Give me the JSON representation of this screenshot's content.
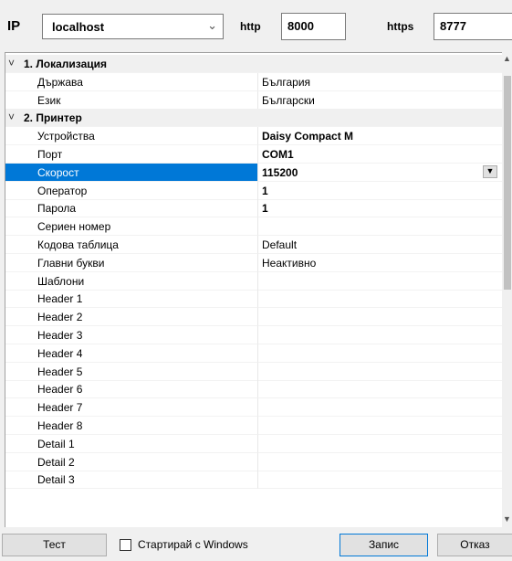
{
  "header": {
    "ip_label": "IP",
    "ip_value": "localhost",
    "http_label": "http",
    "http_value": "8000",
    "https_label": "https",
    "https_value": "8777"
  },
  "grid": {
    "rows": [
      {
        "type": "category",
        "label": "1. Локализация"
      },
      {
        "type": "prop",
        "label": "Държава",
        "value": "България",
        "bold": false
      },
      {
        "type": "prop",
        "label": "Език",
        "value": "Български",
        "bold": false
      },
      {
        "type": "category",
        "label": "2. Принтер"
      },
      {
        "type": "prop",
        "label": "Устройства",
        "value": "Daisy Compact M",
        "bold": true
      },
      {
        "type": "prop",
        "label": "Порт",
        "value": "COM1",
        "bold": true
      },
      {
        "type": "prop",
        "label": "Скорост",
        "value": "115200",
        "bold": true,
        "selected": true,
        "dropdown": true
      },
      {
        "type": "prop",
        "label": "Оператор",
        "value": "1",
        "bold": true
      },
      {
        "type": "prop",
        "label": "Парола",
        "value": "1",
        "bold": true
      },
      {
        "type": "prop",
        "label": "Сериен номер",
        "value": "",
        "bold": false
      },
      {
        "type": "prop",
        "label": "Кодова таблица",
        "value": "Default",
        "bold": false
      },
      {
        "type": "prop",
        "label": "Главни букви",
        "value": "Неактивно",
        "bold": false
      },
      {
        "type": "prop",
        "label": "Шаблони",
        "value": "",
        "bold": false
      },
      {
        "type": "prop",
        "label": "Header 1",
        "value": "",
        "bold": false
      },
      {
        "type": "prop",
        "label": "Header 2",
        "value": "",
        "bold": false
      },
      {
        "type": "prop",
        "label": "Header 3",
        "value": "",
        "bold": false
      },
      {
        "type": "prop",
        "label": "Header 4",
        "value": "",
        "bold": false
      },
      {
        "type": "prop",
        "label": "Header 5",
        "value": "",
        "bold": false
      },
      {
        "type": "prop",
        "label": "Header 6",
        "value": "",
        "bold": false
      },
      {
        "type": "prop",
        "label": "Header 7",
        "value": "",
        "bold": false
      },
      {
        "type": "prop",
        "label": "Header 8",
        "value": "",
        "bold": false
      },
      {
        "type": "prop",
        "label": "Detail 1",
        "value": "",
        "bold": false
      },
      {
        "type": "prop",
        "label": "Detail 2",
        "value": "",
        "bold": false
      },
      {
        "type": "prop",
        "label": "Detail 3",
        "value": "",
        "bold": false
      }
    ]
  },
  "footer": {
    "test_label": "Тест",
    "autostart_label": "Стартирай с Windows",
    "save_label": "Запис",
    "cancel_label": "Отказ"
  },
  "colors": {
    "selection": "#0078d7",
    "category_bg": "#f0f0f0"
  }
}
